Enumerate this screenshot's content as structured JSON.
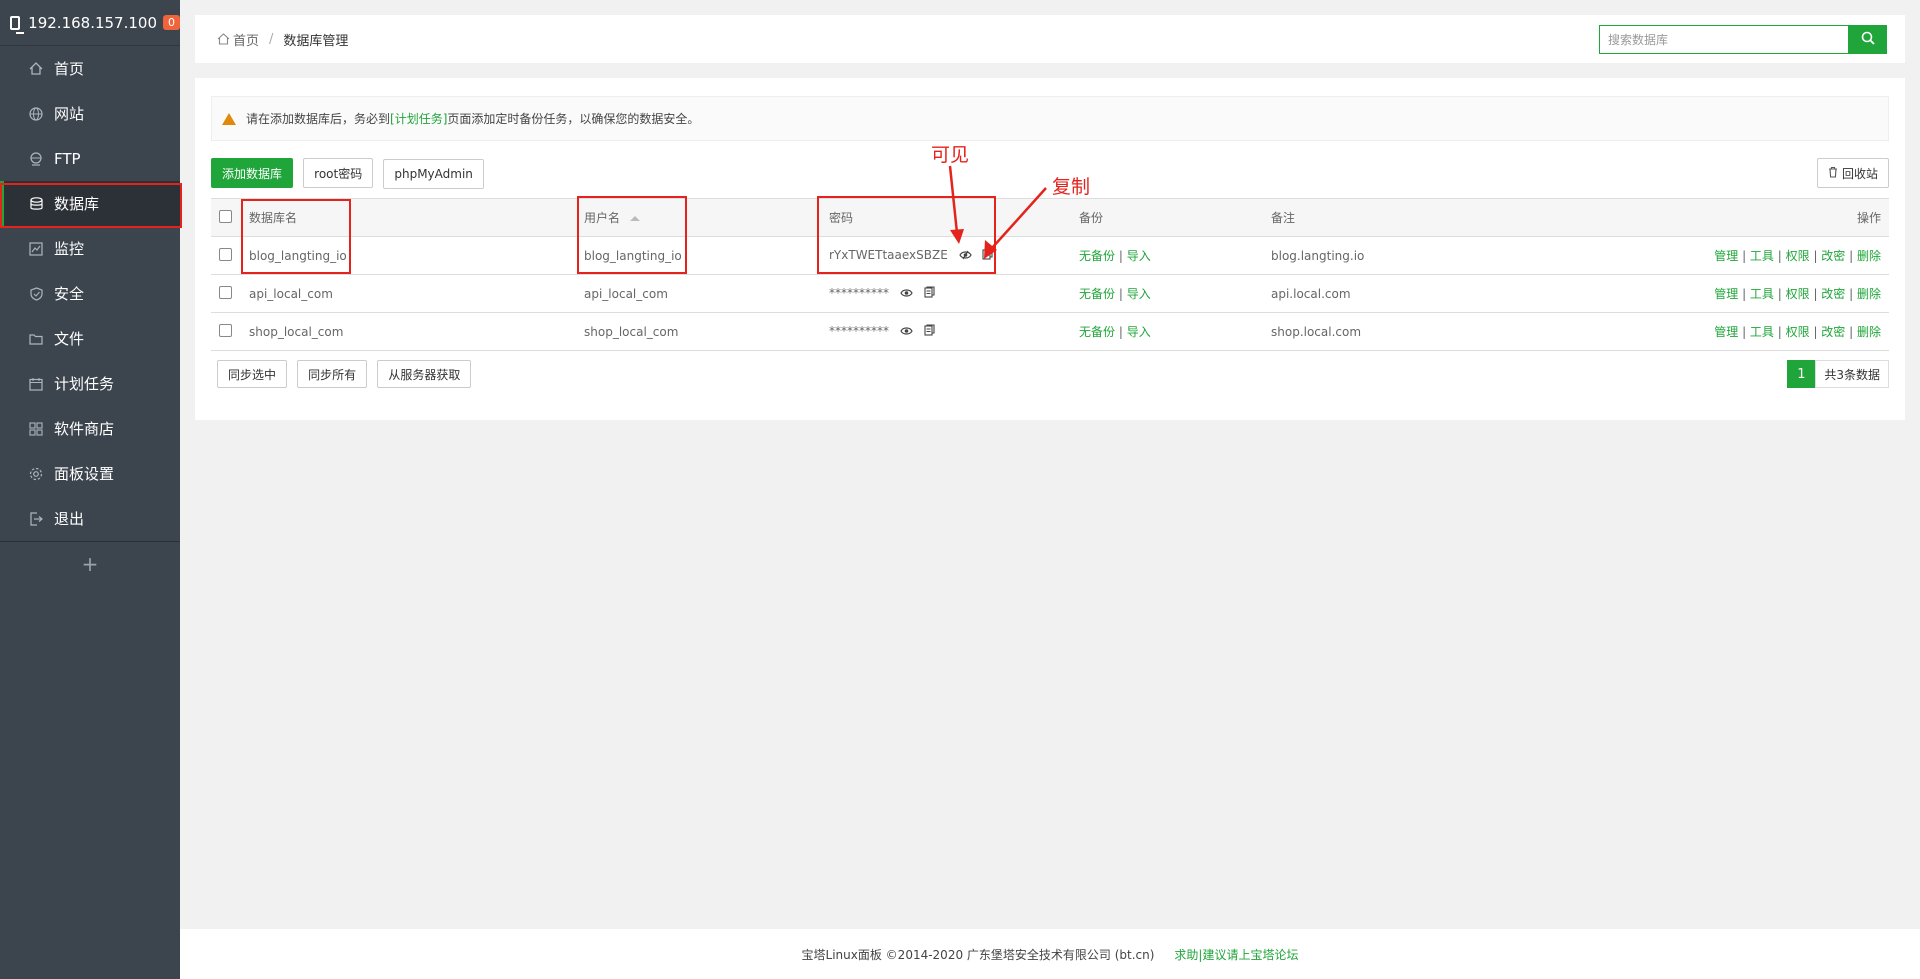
{
  "sidebar": {
    "host": "192.168.157.100",
    "badge": "0",
    "items": [
      {
        "label": "首页",
        "icon": "home-icon"
      },
      {
        "label": "网站",
        "icon": "globe-icon"
      },
      {
        "label": "FTP",
        "icon": "ftp-icon"
      },
      {
        "label": "数据库",
        "icon": "database-icon",
        "active": true
      },
      {
        "label": "监控",
        "icon": "monitor-chart-icon"
      },
      {
        "label": "安全",
        "icon": "shield-icon"
      },
      {
        "label": "文件",
        "icon": "folder-icon"
      },
      {
        "label": "计划任务",
        "icon": "calendar-icon"
      },
      {
        "label": "软件商店",
        "icon": "apps-grid-icon"
      },
      {
        "label": "面板设置",
        "icon": "settings-gear-icon"
      },
      {
        "label": "退出",
        "icon": "logout-icon"
      }
    ],
    "plus": "+"
  },
  "breadcrumb": {
    "home": "首页",
    "sep": "/",
    "current": "数据库管理"
  },
  "search": {
    "placeholder": "搜索数据库"
  },
  "notice": {
    "pre": "请在添加数据库后，务必到",
    "link": "[计划任务]",
    "post": "页面添加定时备份任务，以确保您的数据安全。"
  },
  "toolbar": {
    "add": "添加数据库",
    "root": "root密码",
    "pma": "phpMyAdmin",
    "recycle": "回收站"
  },
  "table": {
    "headers": {
      "name": "数据库名",
      "user": "用户名",
      "password": "密码",
      "backup": "备份",
      "note": "备注",
      "ops": "操作"
    },
    "rows": [
      {
        "name": "blog_langting_io",
        "user": "blog_langting_io",
        "password": "rYxTWETtaaexSBZE",
        "backup": "无备份",
        "import": "导入",
        "note": "blog.langting.io"
      },
      {
        "name": "api_local_com",
        "user": "api_local_com",
        "password": "**********",
        "backup": "无备份",
        "import": "导入",
        "note": "api.local.com"
      },
      {
        "name": "shop_local_com",
        "user": "shop_local_com",
        "password": "**********",
        "backup": "无备份",
        "import": "导入",
        "note": "shop.local.com"
      }
    ],
    "ops": [
      "管理",
      "工具",
      "权限",
      "改密",
      "删除"
    ],
    "op_sep": " | ",
    "backup_sep": " | "
  },
  "bottom": {
    "sync_selected": "同步选中",
    "sync_all": "同步所有",
    "fetch": "从服务器获取"
  },
  "pager": {
    "page": "1",
    "total": "共3条数据"
  },
  "annotations": {
    "visible": "可见",
    "copy": "复制"
  },
  "footer": {
    "copyright": "宝塔Linux面板 ©2014-2020 广东堡塔安全技术有限公司 (bt.cn)",
    "link": "求助|建议请上宝塔论坛"
  },
  "colors": {
    "accent": "#20a53a",
    "sidebar": "#3c444d",
    "annotation": "#e5231d"
  }
}
